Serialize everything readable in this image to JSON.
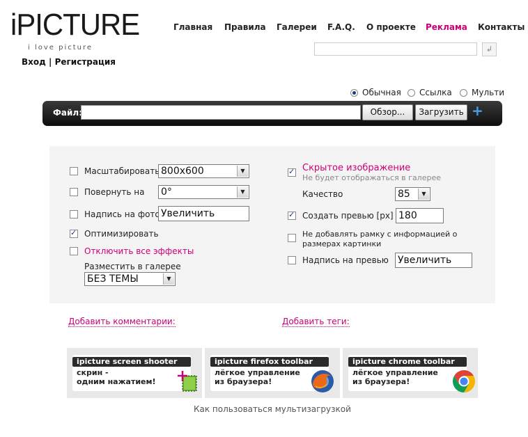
{
  "brand": {
    "logo_text": "iPICTURE",
    "tagline": "i love picture"
  },
  "auth": {
    "login": "Вход",
    "separator": "|",
    "register": "Регистрация"
  },
  "nav": [
    {
      "label": "Главная"
    },
    {
      "label": "Правила"
    },
    {
      "label": "Галереи"
    },
    {
      "label": "F.A.Q."
    },
    {
      "label": "О проекте"
    },
    {
      "label": "Реклама"
    },
    {
      "label": "Контакты"
    }
  ],
  "search": {
    "value": "",
    "button_glyph": "↲"
  },
  "upload_mode": {
    "options": [
      {
        "label": "Обычная",
        "selected": true
      },
      {
        "label": "Ссылка",
        "selected": false
      },
      {
        "label": "Мульти",
        "selected": false
      }
    ]
  },
  "file": {
    "label": "Файл:",
    "value": "",
    "browse_button": "Обзор...",
    "upload_button": "Загрузить",
    "add_icon": "+"
  },
  "options_left": {
    "scale": {
      "label": "Масштабировать",
      "checked": false,
      "value": "800x600"
    },
    "rotate": {
      "label": "Повернуть на",
      "checked": false,
      "value": "0°"
    },
    "caption": {
      "label": "Надпись на фото",
      "checked": false,
      "value": "Увеличить"
    },
    "optimize": {
      "label": "Оптимизировать",
      "checked": true
    },
    "disable_effects": {
      "label": "Отключить все эффекты",
      "checked": false
    },
    "gallery": {
      "label": "Разместить в галерее",
      "value": "БЕЗ ТЕМЫ"
    }
  },
  "options_right": {
    "hidden": {
      "label": "Скрытое изображение",
      "hint": "Не будет отображаться в галерее",
      "checked": true
    },
    "quality": {
      "label": "Качество",
      "value": "85"
    },
    "preview": {
      "label": "Создать превью [px]",
      "checked": true,
      "value": "180"
    },
    "no_frame": {
      "label_line1": "Не добавлять рамку с информацией о",
      "label_line2": "размерах картинки",
      "checked": false
    },
    "preview_caption": {
      "label": "Надпись на превью",
      "checked": false,
      "value": "Увеличить"
    }
  },
  "links": {
    "add_comments": "Добавить комментарии:",
    "add_tags": "Добавить теги:"
  },
  "promos": [
    {
      "title": "ipicture screen shooter",
      "line1": "скрин -",
      "line2": "одним нажатием!"
    },
    {
      "title": "ipicture firefox toolbar",
      "line1": "лёгкое управление",
      "line2": "из браузера!"
    },
    {
      "title": "ipicture chrome toolbar",
      "line1": "лёгкое управление",
      "line2": "из браузера!"
    }
  ],
  "howto": "Как пользоваться мультизагрузкой",
  "colors": {
    "accent": "#cc0077",
    "bar": "#1a1a1a",
    "panel": "#f4f4f4",
    "plus": "#4a9ee6"
  }
}
